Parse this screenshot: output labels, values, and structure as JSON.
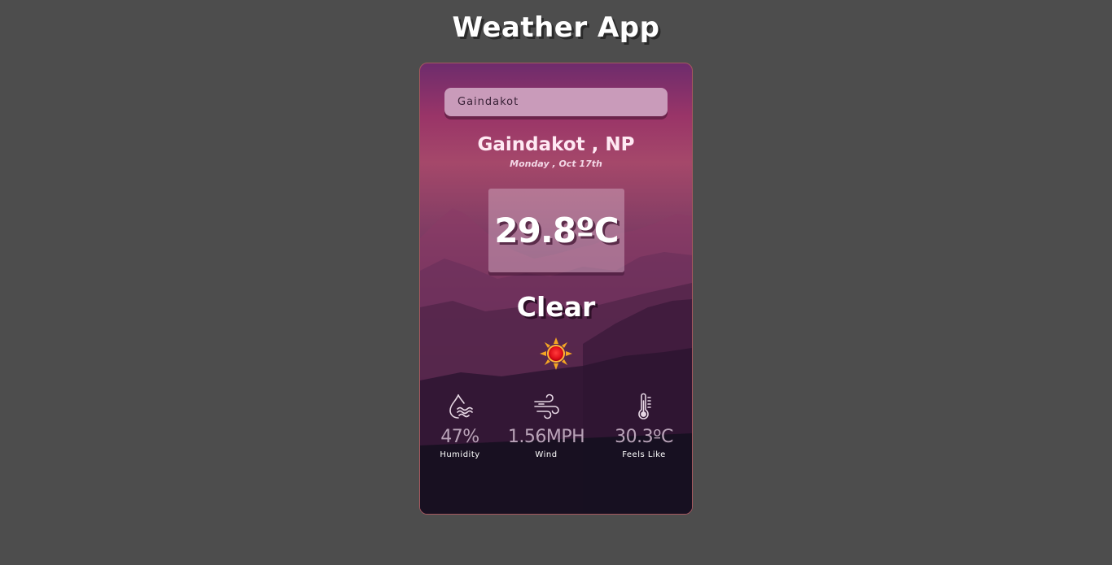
{
  "app": {
    "title": "Weather App"
  },
  "search": {
    "value": "Gaindakot"
  },
  "weather": {
    "location": "Gaindakot , NP",
    "date": "Monday , Oct 17th",
    "temperature": "29.8ºC",
    "condition": "Clear",
    "condition_icon": "sun-icon"
  },
  "stats": [
    {
      "icon": "humidity-icon",
      "value": "47%",
      "label": "Humidity"
    },
    {
      "icon": "wind-icon",
      "value": "1.56MPH",
      "label": "Wind"
    },
    {
      "icon": "thermometer-icon",
      "value": "30.3ºC",
      "label": "Feels Like"
    }
  ],
  "colors": {
    "page_background": "#4d4d4d",
    "card_border": "#a6585e",
    "search_background": "#c99bba",
    "stat_value": "#b9a3b8"
  }
}
